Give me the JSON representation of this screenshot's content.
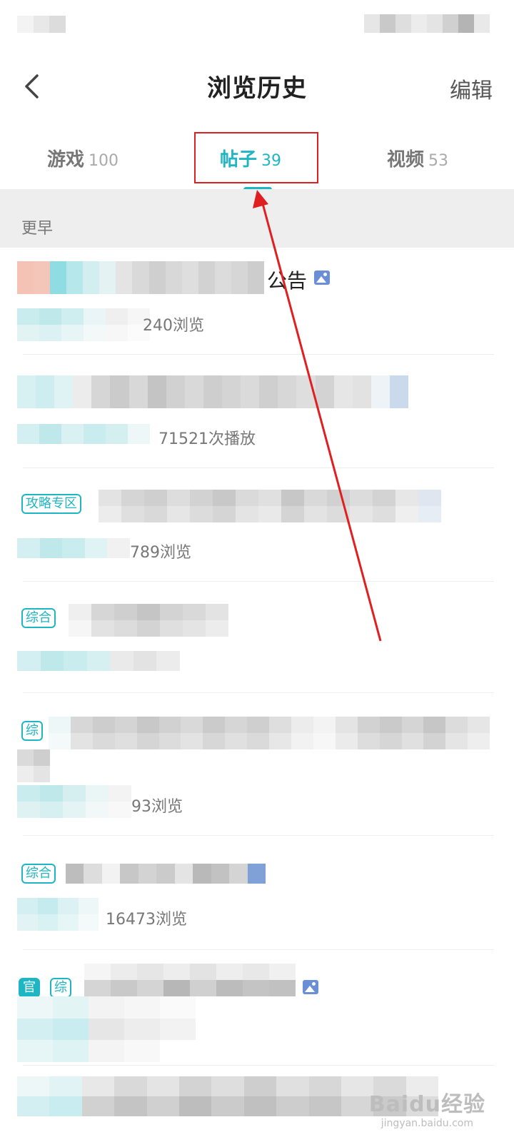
{
  "header": {
    "title": "浏览历史",
    "edit_label": "编辑"
  },
  "tabs": [
    {
      "label": "游戏",
      "count": "100"
    },
    {
      "label": "帖子",
      "count": "39"
    },
    {
      "label": "视频",
      "count": "53"
    }
  ],
  "active_tab": 1,
  "section_label": "更早",
  "items": [
    {
      "title_tail": "公告",
      "meta_tail": "240浏览"
    },
    {
      "meta_tail": "71521次播放"
    },
    {
      "tag": "攻略专区",
      "meta_tail": "789浏览"
    },
    {
      "tag": "综合"
    },
    {
      "tag": "综",
      "meta_tail": "93浏览"
    },
    {
      "tag": "综合",
      "meta_tail": "16473浏览"
    },
    {
      "tag_official": "官",
      "tag": "综"
    }
  ],
  "watermark": {
    "top": "Baidu经验",
    "bottom": "jingyan.baidu.com"
  },
  "colors": {
    "accent": "#1fb6c4",
    "annotation": "#e02020"
  }
}
